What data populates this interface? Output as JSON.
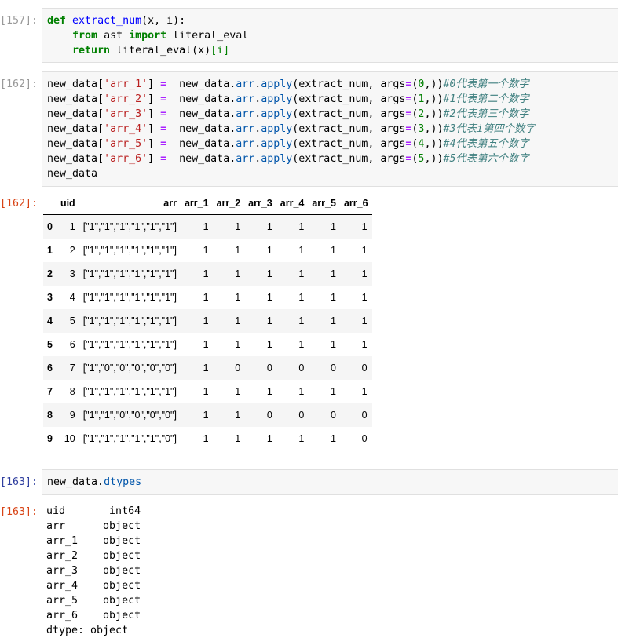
{
  "cells": {
    "c157": {
      "prompt": "[157]:",
      "line1": {
        "kw_def": "def",
        "fn": "extract_num",
        "args": "(x, i):"
      },
      "line2": {
        "kw_from": "from",
        "module": " ast ",
        "kw_import": "import",
        "name": " literal_eval"
      },
      "line3": {
        "kw_return": "return",
        "call": " literal_eval(x)",
        "idx": "[i]"
      }
    },
    "c162": {
      "prompt": "[162]:",
      "lines": [
        {
          "lhs1": "new_data[",
          "key": "'arr_1'",
          "lhs2": "] ",
          "op": "=",
          "sp": "  new_data.",
          "attr1": "arr",
          "dot": ".",
          "attr2": "apply",
          "call": "(extract_num, args",
          "eq": "=",
          "tuple_open": "(",
          "num": "0",
          "tuple_close": ",))",
          "comment": "#0代表第一个数字"
        },
        {
          "lhs1": "new_data[",
          "key": "'arr_2'",
          "lhs2": "] ",
          "op": "=",
          "sp": "  new_data.",
          "attr1": "arr",
          "dot": ".",
          "attr2": "apply",
          "call": "(extract_num, args",
          "eq": "=",
          "tuple_open": "(",
          "num": "1",
          "tuple_close": ",))",
          "comment": "#1代表第二个数字"
        },
        {
          "lhs1": "new_data[",
          "key": "'arr_3'",
          "lhs2": "] ",
          "op": "=",
          "sp": "  new_data.",
          "attr1": "arr",
          "dot": ".",
          "attr2": "apply",
          "call": "(extract_num, args",
          "eq": "=",
          "tuple_open": "(",
          "num": "2",
          "tuple_close": ",))",
          "comment": "#2代表第三个数字"
        },
        {
          "lhs1": "new_data[",
          "key": "'arr_4'",
          "lhs2": "] ",
          "op": "=",
          "sp": "  new_data.",
          "attr1": "arr",
          "dot": ".",
          "attr2": "apply",
          "call": "(extract_num, args",
          "eq": "=",
          "tuple_open": "(",
          "num": "3",
          "tuple_close": ",))",
          "comment": "#3代表i第四个数字"
        },
        {
          "lhs1": "new_data[",
          "key": "'arr_5'",
          "lhs2": "] ",
          "op": "=",
          "sp": "  new_data.",
          "attr1": "arr",
          "dot": ".",
          "attr2": "apply",
          "call": "(extract_num, args",
          "eq": "=",
          "tuple_open": "(",
          "num": "4",
          "tuple_close": ",))",
          "comment": "#4代表第五个数字"
        },
        {
          "lhs1": "new_data[",
          "key": "'arr_6'",
          "lhs2": "] ",
          "op": "=",
          "sp": "  new_data.",
          "attr1": "arr",
          "dot": ".",
          "attr2": "apply",
          "call": "(extract_num, args",
          "eq": "=",
          "tuple_open": "(",
          "num": "5",
          "tuple_close": ",))",
          "comment": "#5代表第六个数字"
        }
      ],
      "last_line": "new_data"
    },
    "out162": {
      "prompt": "[162]:",
      "columns": [
        "",
        "uid",
        "arr",
        "arr_1",
        "arr_2",
        "arr_3",
        "arr_4",
        "arr_5",
        "arr_6"
      ],
      "rows": [
        [
          "0",
          "1",
          "[\"1\",\"1\",\"1\",\"1\",\"1\",\"1\"]",
          "1",
          "1",
          "1",
          "1",
          "1",
          "1"
        ],
        [
          "1",
          "2",
          "[\"1\",\"1\",\"1\",\"1\",\"1\",\"1\"]",
          "1",
          "1",
          "1",
          "1",
          "1",
          "1"
        ],
        [
          "2",
          "3",
          "[\"1\",\"1\",\"1\",\"1\",\"1\",\"1\"]",
          "1",
          "1",
          "1",
          "1",
          "1",
          "1"
        ],
        [
          "3",
          "4",
          "[\"1\",\"1\",\"1\",\"1\",\"1\",\"1\"]",
          "1",
          "1",
          "1",
          "1",
          "1",
          "1"
        ],
        [
          "4",
          "5",
          "[\"1\",\"1\",\"1\",\"1\",\"1\",\"1\"]",
          "1",
          "1",
          "1",
          "1",
          "1",
          "1"
        ],
        [
          "5",
          "6",
          "[\"1\",\"1\",\"1\",\"1\",\"1\",\"1\"]",
          "1",
          "1",
          "1",
          "1",
          "1",
          "1"
        ],
        [
          "6",
          "7",
          "[\"1\",\"0\",\"0\",\"0\",\"0\",\"0\"]",
          "1",
          "0",
          "0",
          "0",
          "0",
          "0"
        ],
        [
          "7",
          "8",
          "[\"1\",\"1\",\"1\",\"1\",\"1\",\"1\"]",
          "1",
          "1",
          "1",
          "1",
          "1",
          "1"
        ],
        [
          "8",
          "9",
          "[\"1\",\"1\",\"0\",\"0\",\"0\",\"0\"]",
          "1",
          "1",
          "0",
          "0",
          "0",
          "0"
        ],
        [
          "9",
          "10",
          "[\"1\",\"1\",\"1\",\"1\",\"1\",\"0\"]",
          "1",
          "1",
          "1",
          "1",
          "1",
          "0"
        ]
      ]
    },
    "c163": {
      "prompt": "[163]:",
      "obj": "new_data.",
      "attr": "dtypes"
    },
    "out163": {
      "prompt": "[163]:",
      "text": "uid       int64\narr      object\narr_1    object\narr_2    object\narr_3    object\narr_4    object\narr_5    object\narr_6    object\ndtype: object"
    }
  }
}
